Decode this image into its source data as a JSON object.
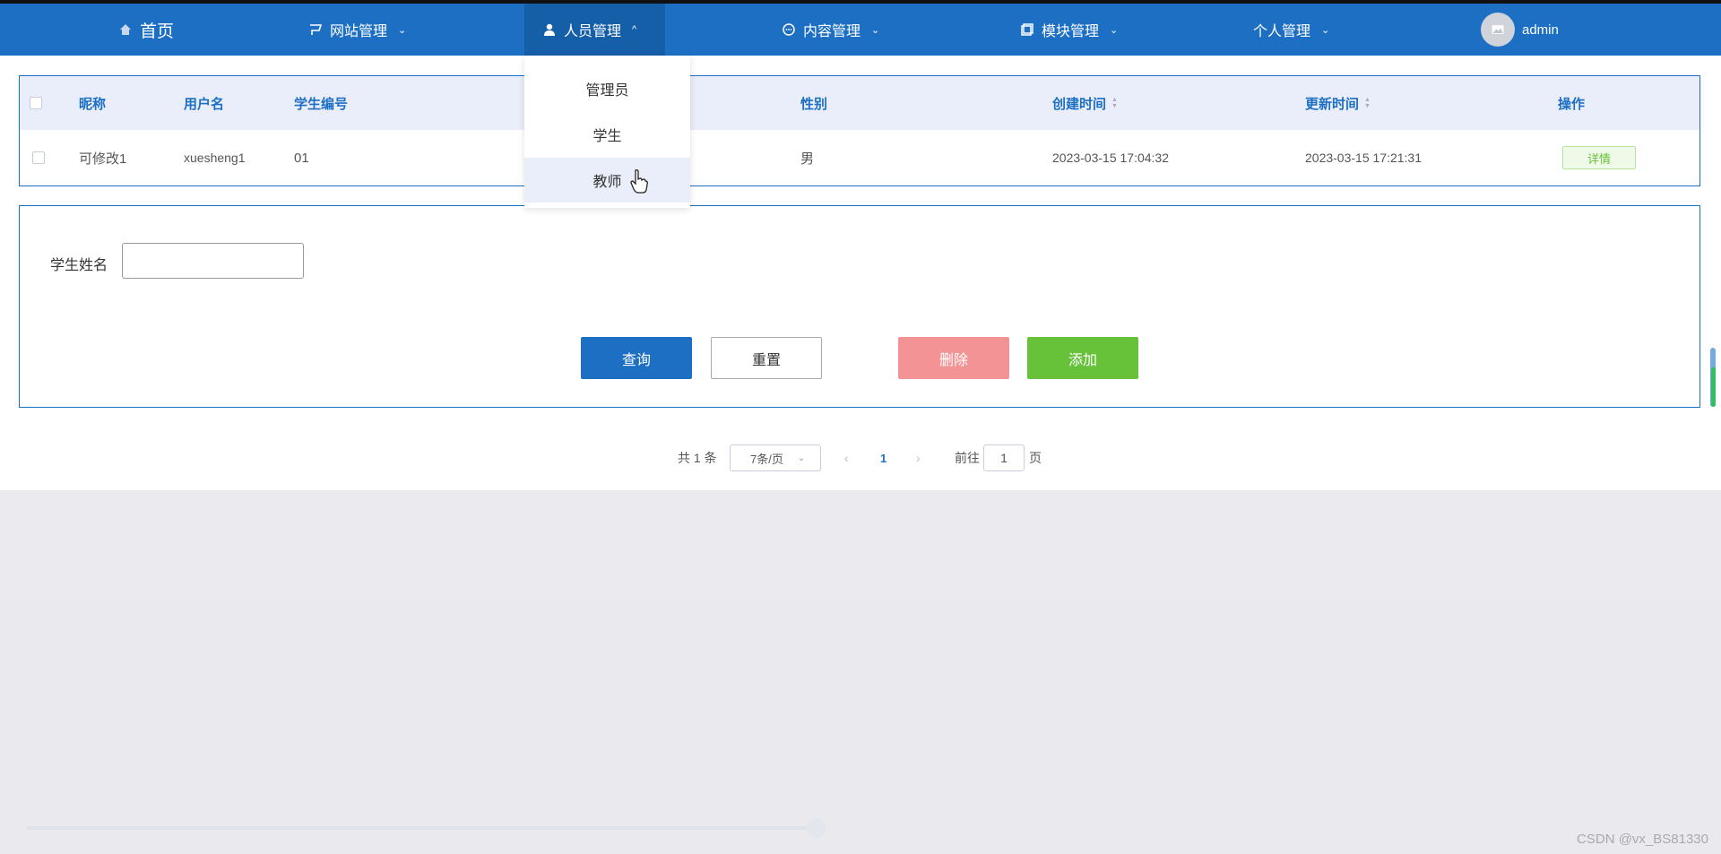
{
  "navbar": {
    "home": "首页",
    "site_mgmt": "网站管理",
    "people_mgmt": "人员管理",
    "content_mgmt": "内容管理",
    "module_mgmt": "模块管理",
    "personal_mgmt": "个人管理",
    "username": "admin",
    "icons": [
      "home-icon",
      "flag-icon",
      "user-icon",
      "chat-icon",
      "module-icon",
      "avatar-icon"
    ]
  },
  "dropdown": {
    "items": [
      "管理员",
      "学生",
      "教师"
    ],
    "hovered": "教师"
  },
  "table": {
    "headers": [
      "昵称",
      "用户名",
      "学生编号",
      "性别",
      "创建时间",
      "更新时间",
      "操作"
    ],
    "rows": [
      {
        "nickname": "可修改1",
        "username": "xuesheng1",
        "student_no": "01",
        "gender": "男",
        "created": "2023-03-15 17:04:32",
        "updated": "2023-03-15 17:21:31",
        "action": "详情"
      }
    ]
  },
  "form": {
    "student_name_label": "学生姓名",
    "student_name_value": "",
    "query": "查询",
    "reset": "重置",
    "delete": "删除",
    "add": "添加"
  },
  "pagination": {
    "total": "共 1 条",
    "page_size": "7条/页",
    "current_page": "1",
    "goto_label": "前往",
    "goto_value": "1",
    "page_suffix": "页"
  },
  "watermark": "CSDN @vx_BS81330",
  "colors": {
    "primary": "#1d6fc4",
    "danger": "#f49395",
    "success": "#67c23a"
  }
}
